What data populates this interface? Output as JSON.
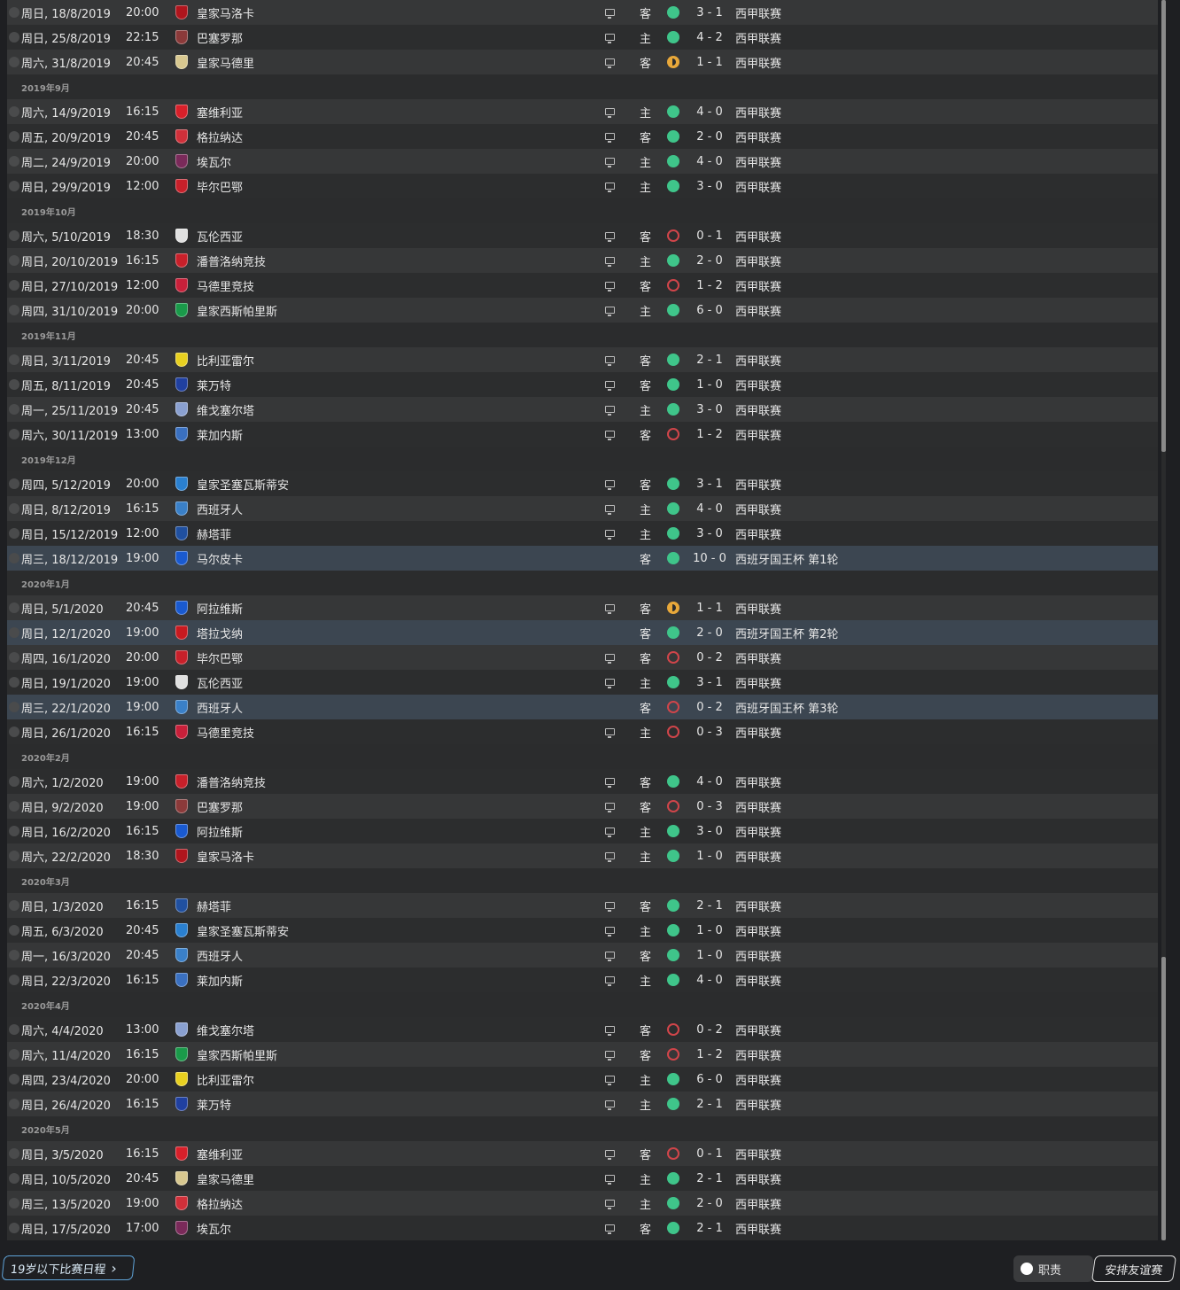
{
  "colors": {
    "win": "#3fc58a",
    "loss": "#d0454a",
    "draw": "#e8a83a",
    "cup_row": "#3c4651"
  },
  "schedule": [
    {
      "month": null,
      "matches": [
        {
          "date": "周日, 18/8/2019",
          "time": "20:00",
          "team": "皇家马洛卡",
          "crest": "#b0151d",
          "tv": true,
          "venue": "客",
          "result": "W",
          "score": "3 - 1",
          "comp": "西甲联赛"
        },
        {
          "date": "周日, 25/8/2019",
          "time": "22:15",
          "team": "巴塞罗那",
          "crest": "#8b3a3a",
          "tv": true,
          "venue": "主",
          "result": "W",
          "score": "4 - 2",
          "comp": "西甲联赛"
        },
        {
          "date": "周六, 31/8/2019",
          "time": "20:45",
          "team": "皇家马德里",
          "crest": "#d8c890",
          "tv": true,
          "venue": "客",
          "result": "D",
          "score": "1 - 1",
          "comp": "西甲联赛"
        }
      ]
    },
    {
      "month": "2019年9月",
      "matches": [
        {
          "date": "周六, 14/9/2019",
          "time": "16:15",
          "team": "塞维利亚",
          "crest": "#d8202a",
          "tv": true,
          "venue": "主",
          "result": "W",
          "score": "4 - 0",
          "comp": "西甲联赛"
        },
        {
          "date": "周五, 20/9/2019",
          "time": "20:45",
          "team": "格拉纳达",
          "crest": "#d0303a",
          "tv": true,
          "venue": "客",
          "result": "W",
          "score": "2 - 0",
          "comp": "西甲联赛"
        },
        {
          "date": "周二, 24/9/2019",
          "time": "20:00",
          "team": "埃瓦尔",
          "crest": "#7a2a5a",
          "tv": true,
          "venue": "主",
          "result": "W",
          "score": "4 - 0",
          "comp": "西甲联赛"
        },
        {
          "date": "周日, 29/9/2019",
          "time": "12:00",
          "team": "毕尔巴鄂",
          "crest": "#c8202a",
          "tv": true,
          "venue": "主",
          "result": "W",
          "score": "3 - 0",
          "comp": "西甲联赛"
        }
      ]
    },
    {
      "month": "2019年10月",
      "matches": [
        {
          "date": "周六, 5/10/2019",
          "time": "18:30",
          "team": "瓦伦西亚",
          "crest": "#e0e0e0",
          "tv": true,
          "venue": "客",
          "result": "L",
          "score": "0 - 1",
          "comp": "西甲联赛"
        },
        {
          "date": "周日, 20/10/2019",
          "time": "16:15",
          "team": "潘普洛纳竞技",
          "crest": "#c8202a",
          "tv": true,
          "venue": "主",
          "result": "W",
          "score": "2 - 0",
          "comp": "西甲联赛"
        },
        {
          "date": "周日, 27/10/2019",
          "time": "12:00",
          "team": "马德里竞技",
          "crest": "#c8203a",
          "tv": true,
          "venue": "客",
          "result": "L",
          "score": "1 - 2",
          "comp": "西甲联赛"
        },
        {
          "date": "周四, 31/10/2019",
          "time": "20:00",
          "team": "皇家西斯帕里斯",
          "crest": "#1a9a4a",
          "tv": true,
          "venue": "主",
          "result": "W",
          "score": "6 - 0",
          "comp": "西甲联赛"
        }
      ]
    },
    {
      "month": "2019年11月",
      "matches": [
        {
          "date": "周日, 3/11/2019",
          "time": "20:45",
          "team": "比利亚雷尔",
          "crest": "#e8d020",
          "tv": true,
          "venue": "客",
          "result": "W",
          "score": "2 - 1",
          "comp": "西甲联赛"
        },
        {
          "date": "周五, 8/11/2019",
          "time": "20:45",
          "team": "莱万特",
          "crest": "#2040a0",
          "tv": true,
          "venue": "客",
          "result": "W",
          "score": "1 - 0",
          "comp": "西甲联赛"
        },
        {
          "date": "周一, 25/11/2019",
          "time": "20:45",
          "team": "维戈塞尔塔",
          "crest": "#8aa0d0",
          "tv": true,
          "venue": "主",
          "result": "W",
          "score": "3 - 0",
          "comp": "西甲联赛"
        },
        {
          "date": "周六, 30/11/2019",
          "time": "13:00",
          "team": "莱加内斯",
          "crest": "#3a70c0",
          "tv": true,
          "venue": "客",
          "result": "L",
          "score": "1 - 2",
          "comp": "西甲联赛"
        }
      ]
    },
    {
      "month": "2019年12月",
      "matches": [
        {
          "date": "周四, 5/12/2019",
          "time": "20:00",
          "team": "皇家圣塞瓦斯蒂安",
          "crest": "#2a80d0",
          "tv": true,
          "venue": "客",
          "result": "W",
          "score": "3 - 1",
          "comp": "西甲联赛"
        },
        {
          "date": "周日, 8/12/2019",
          "time": "16:15",
          "team": "西班牙人",
          "crest": "#3a80c8",
          "tv": true,
          "venue": "主",
          "result": "W",
          "score": "4 - 0",
          "comp": "西甲联赛"
        },
        {
          "date": "周日, 15/12/2019",
          "time": "12:00",
          "team": "赫塔菲",
          "crest": "#2050a0",
          "tv": true,
          "venue": "主",
          "result": "W",
          "score": "3 - 0",
          "comp": "西甲联赛"
        },
        {
          "date": "周三, 18/12/2019",
          "time": "19:00",
          "team": "马尔皮卡",
          "crest": "#1a5ad0",
          "tv": false,
          "venue": "客",
          "result": "W",
          "score": "10 - 0",
          "comp": "西班牙国王杯 第1轮",
          "cup": true
        }
      ]
    },
    {
      "month": "2020年1月",
      "matches": [
        {
          "date": "周日, 5/1/2020",
          "time": "20:45",
          "team": "阿拉维斯",
          "crest": "#1a5ad0",
          "tv": true,
          "venue": "客",
          "result": "D",
          "score": "1 - 1",
          "comp": "西甲联赛"
        },
        {
          "date": "周日, 12/1/2020",
          "time": "19:00",
          "team": "塔拉戈纳",
          "crest": "#c81a20",
          "tv": false,
          "venue": "客",
          "result": "W",
          "score": "2 - 0",
          "comp": "西班牙国王杯 第2轮",
          "cup": true
        },
        {
          "date": "周四, 16/1/2020",
          "time": "20:00",
          "team": "毕尔巴鄂",
          "crest": "#c8202a",
          "tv": true,
          "venue": "客",
          "result": "L",
          "score": "0 - 2",
          "comp": "西甲联赛"
        },
        {
          "date": "周日, 19/1/2020",
          "time": "19:00",
          "team": "瓦伦西亚",
          "crest": "#e0e0e0",
          "tv": true,
          "venue": "主",
          "result": "W",
          "score": "3 - 1",
          "comp": "西甲联赛"
        },
        {
          "date": "周三, 22/1/2020",
          "time": "19:00",
          "team": "西班牙人",
          "crest": "#3a80c8",
          "tv": false,
          "venue": "客",
          "result": "L",
          "score": "0 - 2",
          "comp": "西班牙国王杯 第3轮",
          "cup": true
        },
        {
          "date": "周日, 26/1/2020",
          "time": "16:15",
          "team": "马德里竞技",
          "crest": "#c8203a",
          "tv": true,
          "venue": "主",
          "result": "L",
          "score": "0 - 3",
          "comp": "西甲联赛"
        }
      ]
    },
    {
      "month": "2020年2月",
      "matches": [
        {
          "date": "周六, 1/2/2020",
          "time": "19:00",
          "team": "潘普洛纳竞技",
          "crest": "#c8202a",
          "tv": true,
          "venue": "客",
          "result": "W",
          "score": "4 - 0",
          "comp": "西甲联赛"
        },
        {
          "date": "周日, 9/2/2020",
          "time": "19:00",
          "team": "巴塞罗那",
          "crest": "#8b3a3a",
          "tv": true,
          "venue": "客",
          "result": "L",
          "score": "0 - 3",
          "comp": "西甲联赛"
        },
        {
          "date": "周日, 16/2/2020",
          "time": "16:15",
          "team": "阿拉维斯",
          "crest": "#1a5ad0",
          "tv": true,
          "venue": "主",
          "result": "W",
          "score": "3 - 0",
          "comp": "西甲联赛"
        },
        {
          "date": "周六, 22/2/2020",
          "time": "18:30",
          "team": "皇家马洛卡",
          "crest": "#b0151d",
          "tv": true,
          "venue": "主",
          "result": "W",
          "score": "1 - 0",
          "comp": "西甲联赛"
        }
      ]
    },
    {
      "month": "2020年3月",
      "matches": [
        {
          "date": "周日, 1/3/2020",
          "time": "16:15",
          "team": "赫塔菲",
          "crest": "#2050a0",
          "tv": true,
          "venue": "客",
          "result": "W",
          "score": "2 - 1",
          "comp": "西甲联赛"
        },
        {
          "date": "周五, 6/3/2020",
          "time": "20:45",
          "team": "皇家圣塞瓦斯蒂安",
          "crest": "#2a80d0",
          "tv": true,
          "venue": "主",
          "result": "W",
          "score": "1 - 0",
          "comp": "西甲联赛"
        },
        {
          "date": "周一, 16/3/2020",
          "time": "20:45",
          "team": "西班牙人",
          "crest": "#3a80c8",
          "tv": true,
          "venue": "客",
          "result": "W",
          "score": "1 - 0",
          "comp": "西甲联赛"
        },
        {
          "date": "周日, 22/3/2020",
          "time": "16:15",
          "team": "莱加内斯",
          "crest": "#3a70c0",
          "tv": true,
          "venue": "主",
          "result": "W",
          "score": "4 - 0",
          "comp": "西甲联赛"
        }
      ]
    },
    {
      "month": "2020年4月",
      "matches": [
        {
          "date": "周六, 4/4/2020",
          "time": "13:00",
          "team": "维戈塞尔塔",
          "crest": "#8aa0d0",
          "tv": true,
          "venue": "客",
          "result": "L",
          "score": "0 - 2",
          "comp": "西甲联赛"
        },
        {
          "date": "周六, 11/4/2020",
          "time": "16:15",
          "team": "皇家西斯帕里斯",
          "crest": "#1a9a4a",
          "tv": true,
          "venue": "客",
          "result": "L",
          "score": "1 - 2",
          "comp": "西甲联赛"
        },
        {
          "date": "周四, 23/4/2020",
          "time": "20:00",
          "team": "比利亚雷尔",
          "crest": "#e8d020",
          "tv": true,
          "venue": "主",
          "result": "W",
          "score": "6 - 0",
          "comp": "西甲联赛"
        },
        {
          "date": "周日, 26/4/2020",
          "time": "16:15",
          "team": "莱万特",
          "crest": "#2040a0",
          "tv": true,
          "venue": "主",
          "result": "W",
          "score": "2 - 1",
          "comp": "西甲联赛"
        }
      ]
    },
    {
      "month": "2020年5月",
      "matches": [
        {
          "date": "周日, 3/5/2020",
          "time": "16:15",
          "team": "塞维利亚",
          "crest": "#d8202a",
          "tv": true,
          "venue": "客",
          "result": "L",
          "score": "0 - 1",
          "comp": "西甲联赛"
        },
        {
          "date": "周日, 10/5/2020",
          "time": "20:45",
          "team": "皇家马德里",
          "crest": "#d8c890",
          "tv": true,
          "venue": "主",
          "result": "W",
          "score": "2 - 1",
          "comp": "西甲联赛"
        },
        {
          "date": "周三, 13/5/2020",
          "time": "19:00",
          "team": "格拉纳达",
          "crest": "#d0303a",
          "tv": true,
          "venue": "主",
          "result": "W",
          "score": "2 - 0",
          "comp": "西甲联赛"
        },
        {
          "date": "周日, 17/5/2020",
          "time": "17:00",
          "team": "埃瓦尔",
          "crest": "#7a2a5a",
          "tv": true,
          "venue": "客",
          "result": "W",
          "score": "2 - 1",
          "comp": "西甲联赛"
        }
      ]
    }
  ],
  "footer": {
    "u19_button": "19岁以下比赛日程",
    "u19_chevron": "›",
    "duties_button": "职责",
    "friendly_button": "安排友谊赛"
  }
}
